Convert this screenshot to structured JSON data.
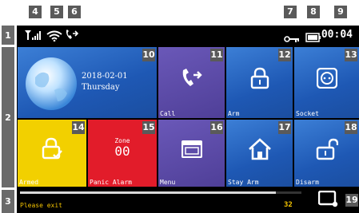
{
  "callouts": {
    "row1": "1",
    "row2": "2",
    "row3": "3",
    "signal": "4",
    "wifi": "5",
    "phone": "6",
    "key": "7",
    "battery": "8",
    "clock": "9",
    "weather_date": "10",
    "call": "11",
    "arm": "12",
    "socket": "13",
    "armed": "14",
    "panic_alarm": "15",
    "menu": "16",
    "stay_arm": "17",
    "disarm": "18",
    "exit_button": "19"
  },
  "status": {
    "time": "00:04",
    "icons": [
      "signal-icon",
      "wifi-icon",
      "phone-forward-icon",
      "key-icon",
      "battery-icon"
    ]
  },
  "tiles": {
    "weather": {
      "date": "2018-02-01",
      "weekday": "Thursday"
    },
    "call": {
      "label": "Call"
    },
    "arm": {
      "label": "Arm"
    },
    "socket": {
      "label": "Socket"
    },
    "armed": {
      "label": "Armed"
    },
    "panic": {
      "label": "Panic Alarm",
      "zone_title": "Zone",
      "zone_number": "00"
    },
    "menu": {
      "label": "Menu"
    },
    "stay_arm": {
      "label": "Stay Arm"
    },
    "disarm": {
      "label": "Disarm"
    }
  },
  "bottom": {
    "message": "Please exit",
    "countdown": "32",
    "progress": 0.91
  },
  "colors": {
    "tile_blue": "#1e58b4",
    "tile_purple": "#4f3f98",
    "tile_yellow": "#f2d000",
    "tile_red": "#e21c2a",
    "message_text": "#f2c200"
  }
}
